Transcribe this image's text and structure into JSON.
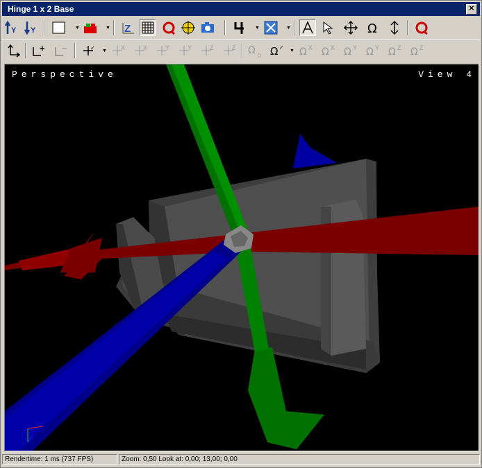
{
  "window": {
    "title": "Hinge 1 x 2 Base",
    "close_glyph": "✕"
  },
  "toolbar1": {
    "buttons": [
      {
        "icon": "rotate-up-y-icon",
        "text": "↑Y"
      },
      {
        "icon": "rotate-down-y-icon",
        "text": "↓Y"
      },
      {
        "icon": "color-swatch-icon"
      },
      {
        "icon": "brick-color-icon"
      },
      {
        "icon": "z-axis-icon",
        "text": "Z"
      },
      {
        "icon": "grid-icon"
      },
      {
        "icon": "refresh-red-icon"
      },
      {
        "icon": "target-icon"
      },
      {
        "icon": "camera-icon"
      },
      {
        "icon": "digit-4-icon",
        "text": "4"
      },
      {
        "icon": "zoom-fit-icon"
      },
      {
        "icon": "letter-a-icon",
        "text": "A"
      },
      {
        "icon": "arrow-select-icon"
      },
      {
        "icon": "move-cross-icon"
      },
      {
        "icon": "rotate-omega-icon",
        "text": "Ω"
      },
      {
        "icon": "vertical-move-icon"
      },
      {
        "icon": "reset-red-icon"
      }
    ]
  },
  "toolbar2": {
    "buttons": [
      {
        "icon": "axis-corner-icon"
      },
      {
        "icon": "axis-plus-icon",
        "text": "+"
      },
      {
        "icon": "axis-minus-icon",
        "text": "−"
      },
      {
        "icon": "move-snap-icon"
      },
      {
        "icon": "move-minus-x-icon",
        "text": "-X"
      },
      {
        "icon": "move-plus-x-icon",
        "text": "+X"
      },
      {
        "icon": "move-minus-y-icon",
        "text": "-Y"
      },
      {
        "icon": "move-plus-y-icon",
        "text": "+Y"
      },
      {
        "icon": "move-minus-z-icon",
        "text": "-Z"
      },
      {
        "icon": "move-plus-z-icon",
        "text": "+Z"
      },
      {
        "icon": "rotate-zero-icon",
        "text": "Ω₀"
      },
      {
        "icon": "rotate-snap-icon",
        "text": "Ω"
      },
      {
        "icon": "rotate-minus-x-icon",
        "text": "-X"
      },
      {
        "icon": "rotate-plus-x-icon",
        "text": "+X"
      },
      {
        "icon": "rotate-minus-y-icon",
        "text": "-Y"
      },
      {
        "icon": "rotate-plus-y-icon",
        "text": "+Y"
      },
      {
        "icon": "rotate-minus-z-icon",
        "text": "-Z"
      },
      {
        "icon": "rotate-plus-z-icon",
        "text": "+Z"
      }
    ]
  },
  "viewport": {
    "label_left": "Perspective",
    "label_right": "View 4",
    "colors": {
      "background": "#000000",
      "x_axis": "#8b0000",
      "y_axis": "#008000",
      "z_axis": "#00008b",
      "part": "#4a4a4a"
    }
  },
  "status": {
    "render": "Rendertime: 1 ms (737 FPS)",
    "zoom": "Zoom: 0,50  Look at: 0,00; 13,00; 0,00"
  }
}
